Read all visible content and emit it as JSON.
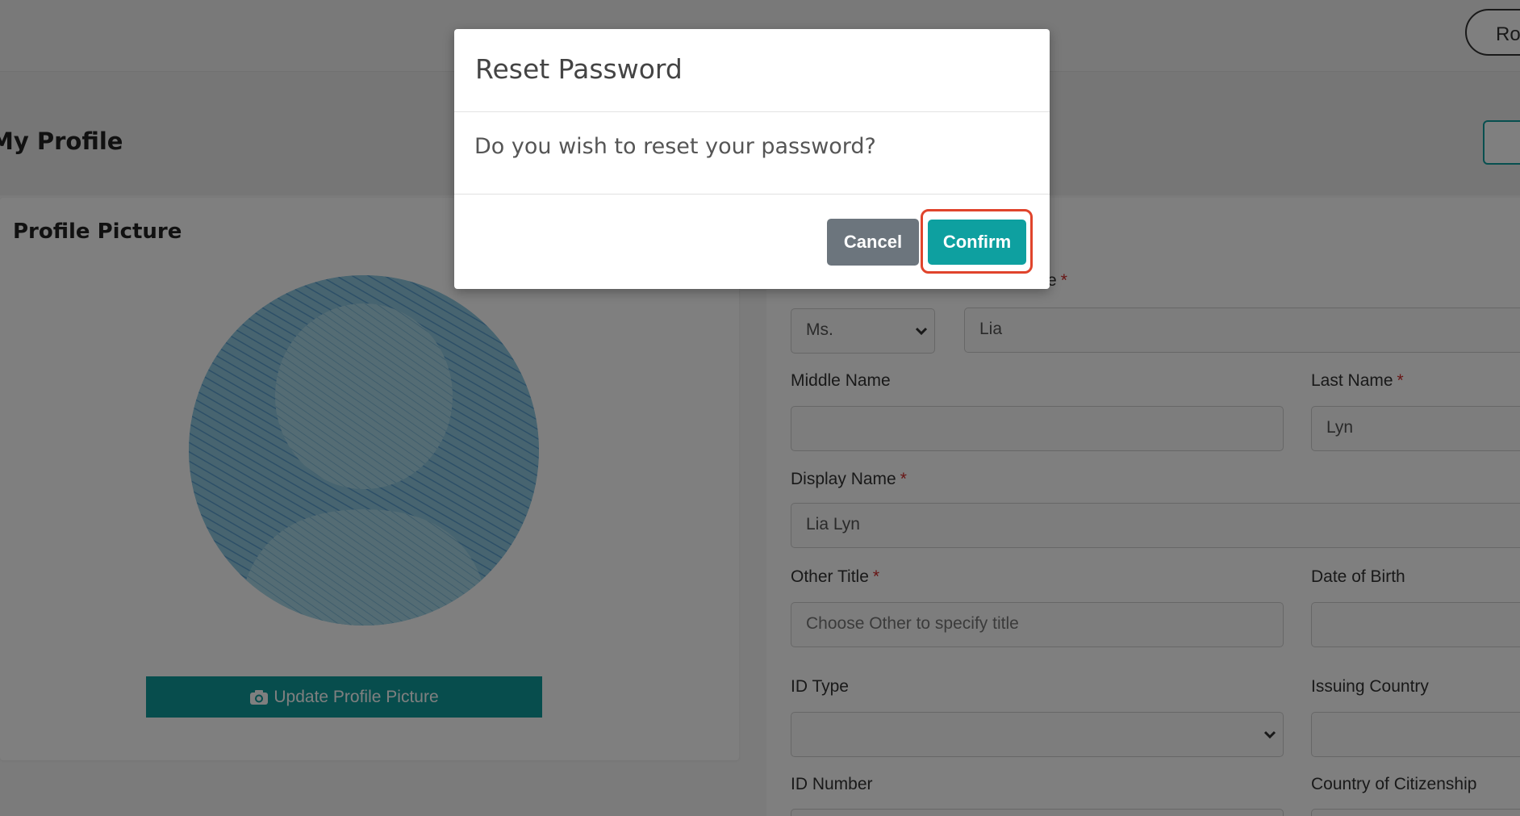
{
  "header": {
    "role_button_label": "Ro"
  },
  "page": {
    "title": "My Profile"
  },
  "profile_picture": {
    "title": "Profile Picture",
    "update_button_label": "Update Profile Picture"
  },
  "form": {
    "title_label_partial": "e",
    "title_select_value": "Ms.",
    "first_name_value": "Lia",
    "middle_name_label": "Middle Name",
    "middle_name_value": "",
    "last_name_label": "Last Name",
    "last_name_value": "Lyn",
    "display_name_label": "Display Name",
    "display_name_value": "Lia Lyn",
    "other_title_label": "Other Title",
    "other_title_placeholder": "Choose Other to specify title",
    "date_of_birth_label": "Date of Birth",
    "date_of_birth_value": "",
    "id_type_label": "ID Type",
    "id_type_value": "",
    "issuing_country_label": "Issuing Country",
    "issuing_country_value": "",
    "id_number_label": "ID Number",
    "country_of_citizenship_label": "Country of Citizenship",
    "required_marker": "*"
  },
  "modal": {
    "title": "Reset Password",
    "message": "Do you wish to reset your password?",
    "cancel_label": "Cancel",
    "confirm_label": "Confirm"
  },
  "colors": {
    "accent": "#0ea0a0",
    "required": "#d02a2a",
    "highlight": "#e0442c",
    "cancel": "#6c757d"
  }
}
